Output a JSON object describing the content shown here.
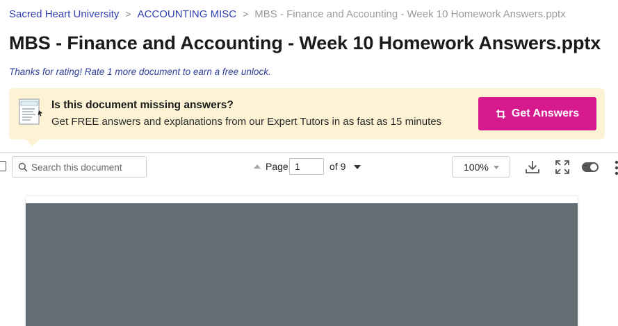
{
  "breadcrumb": {
    "items": [
      "Sacred Heart University",
      "ACCOUNTING MISC"
    ],
    "current": "MBS - Finance and Accounting - Week 10 Homework Answers.pptx",
    "separator": ">"
  },
  "title": "MBS - Finance and Accounting - Week 10 Homework Answers.pptx",
  "rating_message": "Thanks for rating! Rate 1 more document to earn a free unlock.",
  "banner": {
    "heading": "Is this document missing answers?",
    "text": "Get FREE answers and explanations from our Expert Tutors in as fast as 15 minutes",
    "button_label": "Get Answers",
    "button_color": "#d6198d",
    "background_color": "#fdf3d4"
  },
  "toolbar": {
    "search_placeholder": "Search this document",
    "page_label": "Page",
    "page_value": "1",
    "page_of": "of 9",
    "zoom": "100%",
    "icons": [
      "search-icon",
      "download-icon",
      "fullscreen-icon",
      "toggle-switch",
      "more-vertical-icon"
    ]
  },
  "colors": {
    "link": "#2f3fb0",
    "slide_background": "#646d72"
  }
}
